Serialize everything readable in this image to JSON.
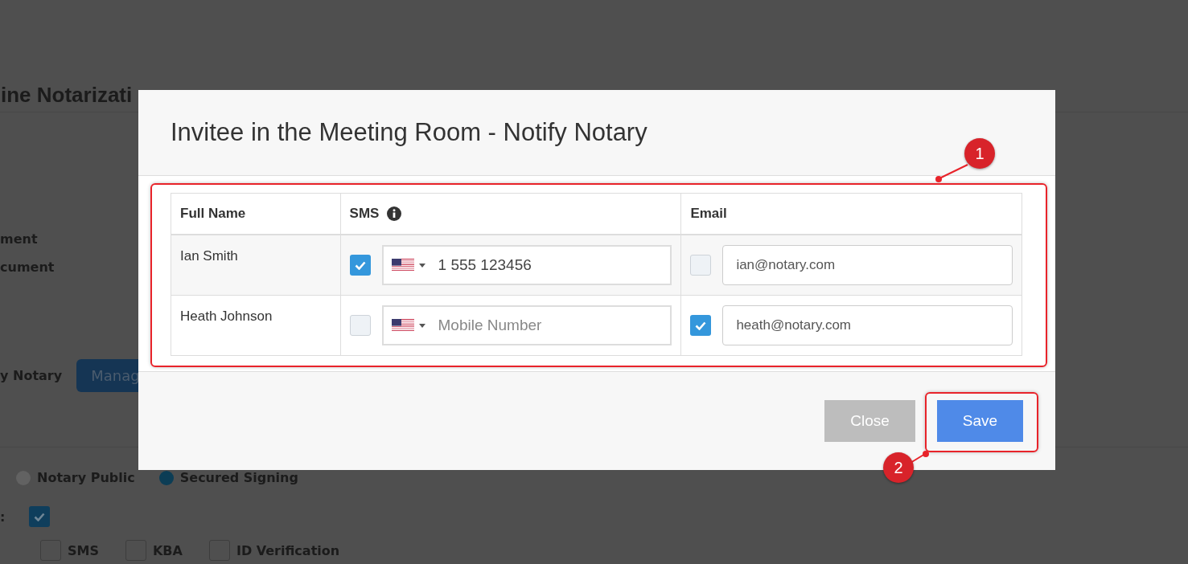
{
  "page": {
    "title": "ine Notarizati",
    "labels": [
      "ment",
      "cument"
    ],
    "notary_label": "y Notary",
    "manage_button": "Manag",
    "radios": [
      {
        "label": "Notary Public",
        "selected": false
      },
      {
        "label": "Secured Signing",
        "selected": true
      }
    ],
    "colon": ":",
    "main_checked": true,
    "options": [
      {
        "label": "SMS",
        "checked": false
      },
      {
        "label": "KBA",
        "checked": false
      },
      {
        "label": "ID Verification",
        "checked": false
      }
    ]
  },
  "dialog": {
    "title": "Invitee in the Meeting Room - Notify Notary",
    "columns": [
      "Full Name",
      "SMS",
      "Email"
    ],
    "rows": [
      {
        "name": "Ian Smith",
        "sms_checked": true,
        "phone": "1 555 123456",
        "email_checked": false,
        "email": "ian@notary.com"
      },
      {
        "name": "Heath Johnson",
        "sms_checked": false,
        "phone_placeholder": "Mobile Number",
        "email_checked": true,
        "email": "heath@notary.com"
      }
    ],
    "buttons": [
      {
        "label": "Close",
        "kind": "secondary"
      },
      {
        "label": "Save",
        "kind": "primary"
      }
    ]
  },
  "annotations": [
    {
      "label": "1"
    },
    {
      "label": "2"
    }
  ]
}
